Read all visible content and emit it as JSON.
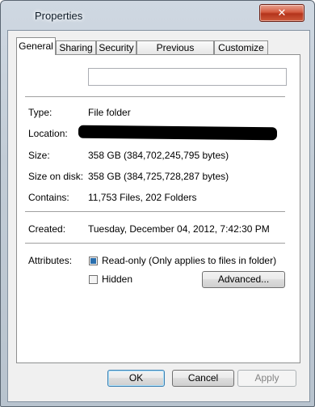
{
  "window": {
    "title": "Properties",
    "close_glyph": "✕"
  },
  "tabs": [
    {
      "label": "General",
      "active": true
    },
    {
      "label": "Sharing",
      "active": false
    },
    {
      "label": "Security",
      "active": false
    },
    {
      "label": "Previous Versions",
      "active": false
    },
    {
      "label": "Customize",
      "active": false
    }
  ],
  "general": {
    "name_value": "",
    "rows": [
      {
        "label": "Type:",
        "value": "File folder"
      },
      {
        "label": "Location:",
        "value": ""
      },
      {
        "label": "Size:",
        "value": "358 GB (384,702,245,795 bytes)"
      },
      {
        "label": "Size on disk:",
        "value": "358 GB (384,725,728,287 bytes)"
      },
      {
        "label": "Contains:",
        "value": "11,753 Files, 202 Folders"
      },
      {
        "label": "Created:",
        "value": "Tuesday, December 04, 2012, 7:42:30 PM"
      }
    ],
    "attributes_label": "Attributes:",
    "readonly_label": "Read-only (Only applies to files in folder)",
    "readonly_state": "indeterminate",
    "hidden_label": "Hidden",
    "hidden_checked": false,
    "advanced_label": "Advanced..."
  },
  "buttons": {
    "ok": "OK",
    "cancel": "Cancel",
    "apply": "Apply"
  }
}
